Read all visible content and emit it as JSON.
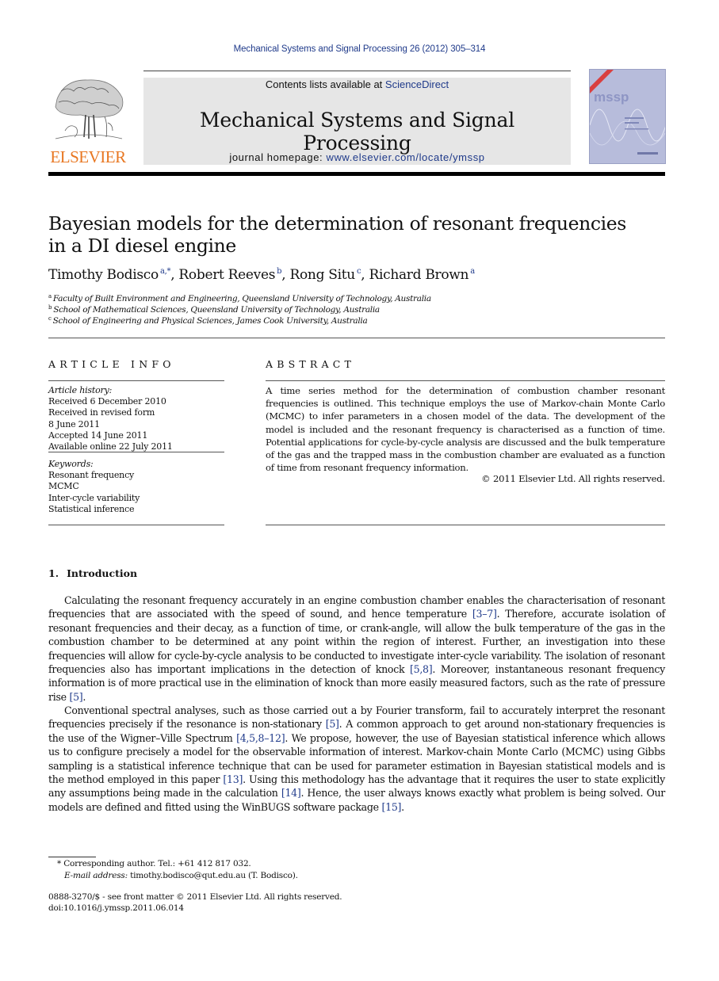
{
  "running_head": "Mechanical Systems and Signal Processing 26 (2012) 305–314",
  "masthead": {
    "contents_prefix": "Contents lists available at ",
    "contents_link": "ScienceDirect",
    "journal_title": "Mechanical Systems and Signal Processing",
    "homepage_prefix": "journal homepage: ",
    "homepage_link": "www.elsevier.com/locate/ymssp",
    "publisher_logo_text": "ELSEVIER",
    "cover_label": "mssp",
    "accent_color": "#1f3a8a",
    "logo_color": "#e87722"
  },
  "article": {
    "title_line1": "Bayesian models for the determination of resonant frequencies",
    "title_line2": "in a DI diesel engine",
    "authors": [
      {
        "name": "Timothy Bodisco",
        "sup": "a,*",
        "sep": ", "
      },
      {
        "name": "Robert Reeves",
        "sup": "b",
        "sep": ", "
      },
      {
        "name": "Rong Situ",
        "sup": "c",
        "sep": ", "
      },
      {
        "name": "Richard Brown",
        "sup": "a",
        "sep": ""
      }
    ],
    "affiliations": [
      {
        "key": "a",
        "text": "Faculty of Built Environment and Engineering, Queensland University of Technology, Australia"
      },
      {
        "key": "b",
        "text": "School of Mathematical Sciences, Queensland University of Technology, Australia"
      },
      {
        "key": "c",
        "text": "School of Engineering and Physical Sciences, James Cook University, Australia"
      }
    ]
  },
  "article_info": {
    "heading": "ARTICLE INFO",
    "history_label": "Article history:",
    "history": [
      "Received 6 December 2010",
      "Received in revised form",
      "8 June 2011",
      "Accepted 14 June 2011",
      "Available online 22 July 2011"
    ],
    "keywords_label": "Keywords:",
    "keywords": [
      "Resonant frequency",
      "MCMC",
      "Inter-cycle variability",
      "Statistical inference"
    ]
  },
  "abstract": {
    "heading": "ABSTRACT",
    "body": "A time series method for the determination of combustion chamber resonant frequencies is outlined. This technique employs the use of Markov-chain Monte Carlo (MCMC) to infer parameters in a chosen model of the data. The development of the model is included and the resonant frequency is characterised as a function of time. Potential applications for cycle-by-cycle analysis are discussed and the bulk temperature of the gas and the trapped mass in the combustion chamber are evaluated as a function of time from resonant frequency information.",
    "copyright": "© 2011 Elsevier Ltd. All rights reserved."
  },
  "introduction": {
    "number": "1.",
    "title": "Introduction",
    "paragraphs": [
      [
        {
          "t": "Calculating the resonant frequency accurately in an engine combustion chamber enables the characterisation of resonant frequencies that are associated with the speed of sound, and hence temperature "
        },
        {
          "ref": "[3–7]"
        },
        {
          "t": ". Therefore, accurate isolation of resonant frequencies and their decay, as a function of time, or crank-angle, will allow the bulk temperature of the gas in the combustion chamber to be determined at any point within the region of interest. Further, an investigation into these frequencies will allow for cycle-by-cycle analysis to be conducted to investigate inter-cycle variability. The isolation of resonant frequencies also has important implications in the detection of knock "
        },
        {
          "ref": "[5,8]"
        },
        {
          "t": ". Moreover, instantaneous resonant frequency information is of more practical use in the elimination of knock than more easily measured factors, such as the rate of pressure rise "
        },
        {
          "ref": "[5]"
        },
        {
          "t": "."
        }
      ],
      [
        {
          "t": "Conventional spectral analyses, such as those carried out a by Fourier transform, fail to accurately interpret the resonant frequencies precisely if the resonance is non-stationary "
        },
        {
          "ref": "[5]"
        },
        {
          "t": ". A common approach to get around non-stationary frequencies is the use of the Wigner–Ville Spectrum "
        },
        {
          "ref": "[4,5,8–12]"
        },
        {
          "t": ". We propose, however, the use of Bayesian statistical inference which allows us to configure precisely a model for the observable information of interest. Markov-chain Monte Carlo (MCMC) using Gibbs sampling is a statistical inference technique that can be used for parameter estimation in Bayesian statistical models and is the method employed in this paper "
        },
        {
          "ref": "[13]"
        },
        {
          "t": ". Using this methodology has the advantage that it requires the user to state explicitly any assumptions being made in the calculation "
        },
        {
          "ref": "[14]"
        },
        {
          "t": ". Hence, the user always knows exactly what problem is being solved. Our models are defined and fitted using the WinBUGS software package "
        },
        {
          "ref": "[15]"
        },
        {
          "t": "."
        }
      ]
    ]
  },
  "footnotes": {
    "corresponding": "* Corresponding author. Tel.: +61 412 817 032.",
    "email_label": "E-mail address:",
    "email_value": " timothy.bodisco@qut.edu.au (T. Bodisco).",
    "issn_line": "0888-3270/$ - see front matter © 2011 Elsevier Ltd. All rights reserved.",
    "doi": "doi:10.1016/j.ymssp.2011.06.014"
  }
}
